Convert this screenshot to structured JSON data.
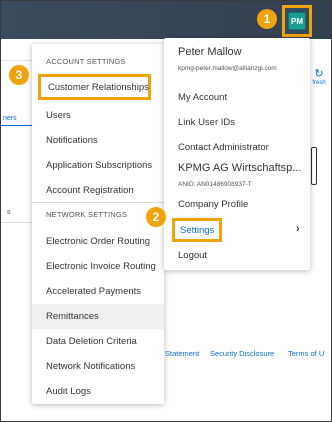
{
  "shell": {
    "avatar_initials": "PM",
    "steps": [
      "1",
      "2",
      "3"
    ]
  },
  "background": {
    "left_fragment_1": "ners",
    "left_fragment_2": "s",
    "refresh_label": "fresh",
    "footer_links": [
      "Statement",
      "Security Disclosure",
      "Terms of U"
    ]
  },
  "settings_menu": {
    "account_section": "ACCOUNT SETTINGS",
    "account_items": [
      "Customer Relationships",
      "Users",
      "Notifications",
      "Application Subscriptions",
      "Account Registration"
    ],
    "network_section": "NETWORK SETTINGS",
    "network_items": [
      "Electronic Order Routing",
      "Electronic Invoice Routing",
      "Accelerated Payments",
      "Remittances",
      "Data Deletion Criteria",
      "Network Notifications",
      "Audit Logs"
    ],
    "highlighted_item": "Remittances"
  },
  "user_menu": {
    "name": "Peter Mallow",
    "email": "kpmg-peter.mallow@allianzgi.com",
    "items": [
      "My Account",
      "Link User IDs",
      "Contact Administrator"
    ],
    "company_name": "KPMG AG Wirtschaftsp...",
    "anid": "ANID: AN01486908937-T",
    "company_profile": "Company Profile",
    "settings": "Settings",
    "logout": "Logout"
  },
  "colors": {
    "shellbar": "#3b4a5c",
    "highlight": "#f0a30a",
    "avatar": "#1a9e8f",
    "link": "#0a6ed1"
  }
}
